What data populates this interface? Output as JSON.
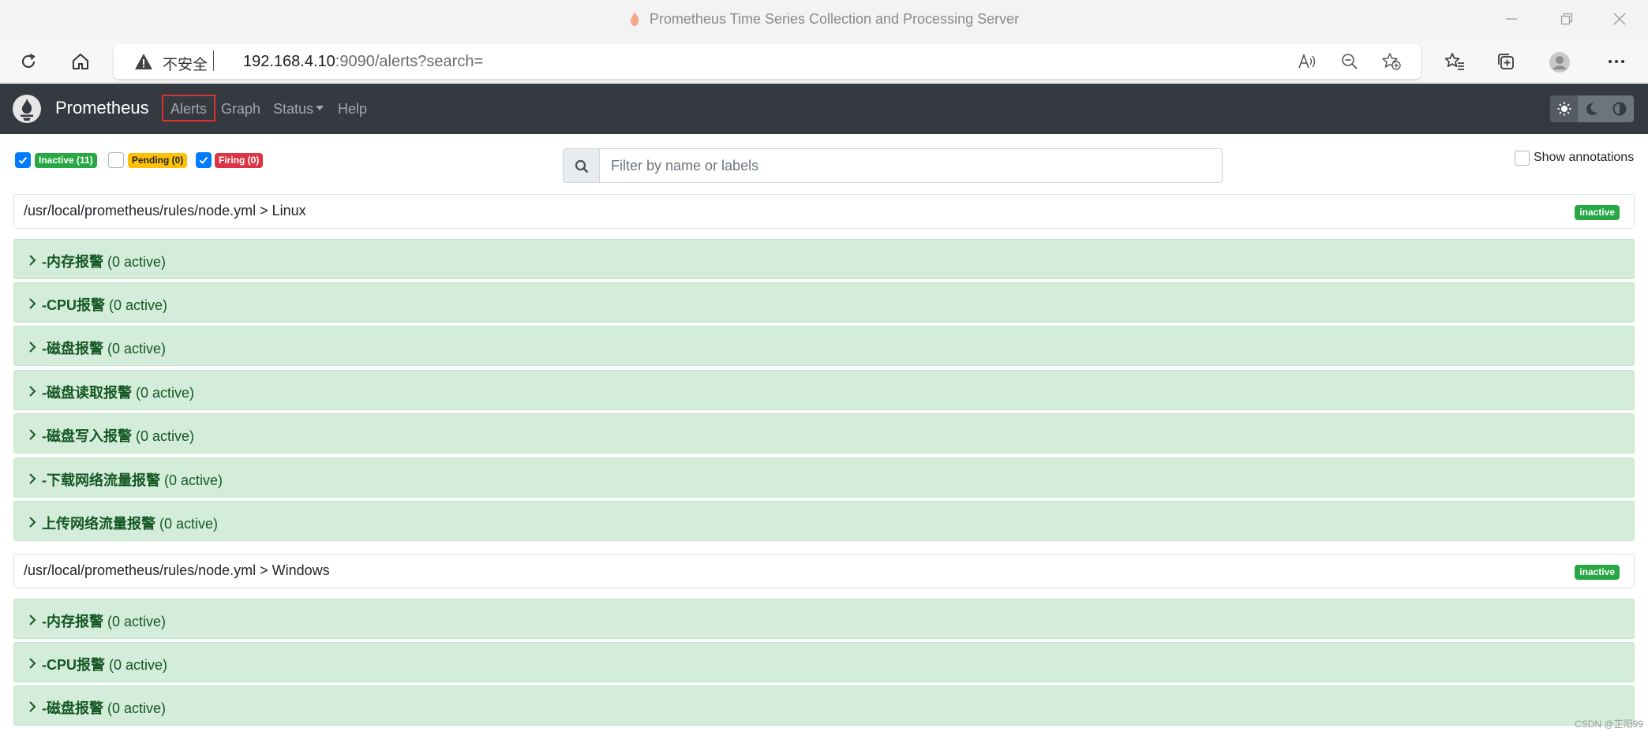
{
  "window": {
    "title": "Prometheus Time Series Collection and Processing Server",
    "icon": "prometheus-flame-icon"
  },
  "browser": {
    "security_label": "不安全",
    "url_host": "192.168.4.10",
    "url_rest": ":9090/alerts?search="
  },
  "navbar": {
    "brand": "Prometheus",
    "links": {
      "alerts": "Alerts",
      "graph": "Graph",
      "status": "Status",
      "help": "Help"
    },
    "theme_modes": [
      "light",
      "dark",
      "browser-default"
    ],
    "active_theme": "light"
  },
  "filters": {
    "inactive": {
      "label": "Inactive (11)",
      "checked": true,
      "color": "#28a745"
    },
    "pending": {
      "label": "Pending (0)",
      "checked": false,
      "color": "#ffc107"
    },
    "firing": {
      "label": "Firing (0)",
      "checked": true,
      "color": "#dc3545"
    }
  },
  "search": {
    "placeholder": "Filter by name or labels",
    "value": ""
  },
  "show_annotations": {
    "label": "Show annotations",
    "checked": false
  },
  "groups": [
    {
      "path": "/usr/local/prometheus/rules/node.yml > Linux",
      "state": "inactive",
      "rules": [
        {
          "name": "-内存报警",
          "count": "(0 active)"
        },
        {
          "name": "-CPU报警",
          "count": "(0 active)"
        },
        {
          "name": "-磁盘报警",
          "count": "(0 active)"
        },
        {
          "name": "-磁盘读取报警",
          "count": "(0 active)"
        },
        {
          "name": "-磁盘写入报警",
          "count": "(0 active)"
        },
        {
          "name": "-下载网络流量报警",
          "count": "(0 active)"
        },
        {
          "name": "上传网络流量报警",
          "count": "(0 active)"
        }
      ]
    },
    {
      "path": "/usr/local/prometheus/rules/node.yml > Windows",
      "state": "inactive",
      "rules": [
        {
          "name": "-内存报警",
          "count": "(0 active)"
        },
        {
          "name": "-CPU报警",
          "count": "(0 active)"
        },
        {
          "name": "-磁盘报警",
          "count": "(0 active)"
        }
      ]
    }
  ],
  "watermark": "CSDN @芷阳99"
}
